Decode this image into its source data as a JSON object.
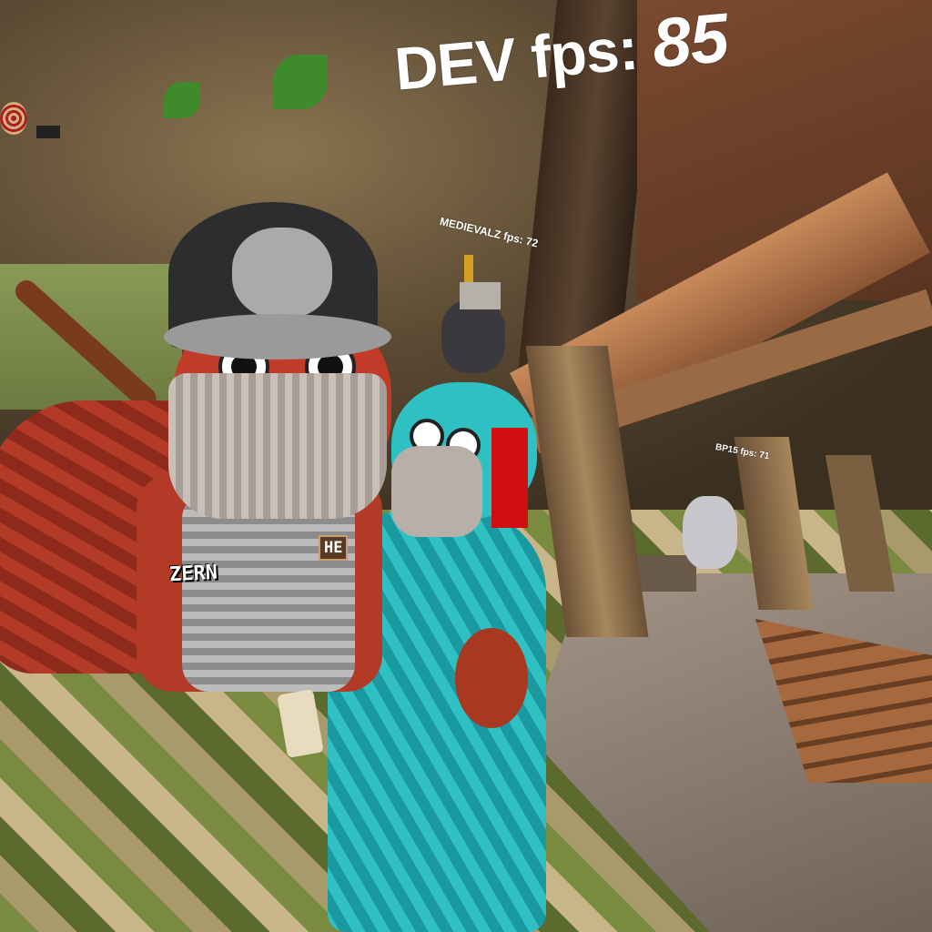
{
  "hud": {
    "dev_label": "DEV fps: ",
    "dev_fps": "85"
  },
  "players": [
    {
      "tag": "MEDIEVALZ fps: 72"
    },
    {
      "tag": "BP15 fps: 71"
    }
  ],
  "cosmetics": {
    "name_badge": "ZERN",
    "patch": "HE"
  },
  "colors": {
    "fur_red": "#b23a26",
    "fur_cyan": "#2fc0c4",
    "hud_text": "#ffffff"
  }
}
